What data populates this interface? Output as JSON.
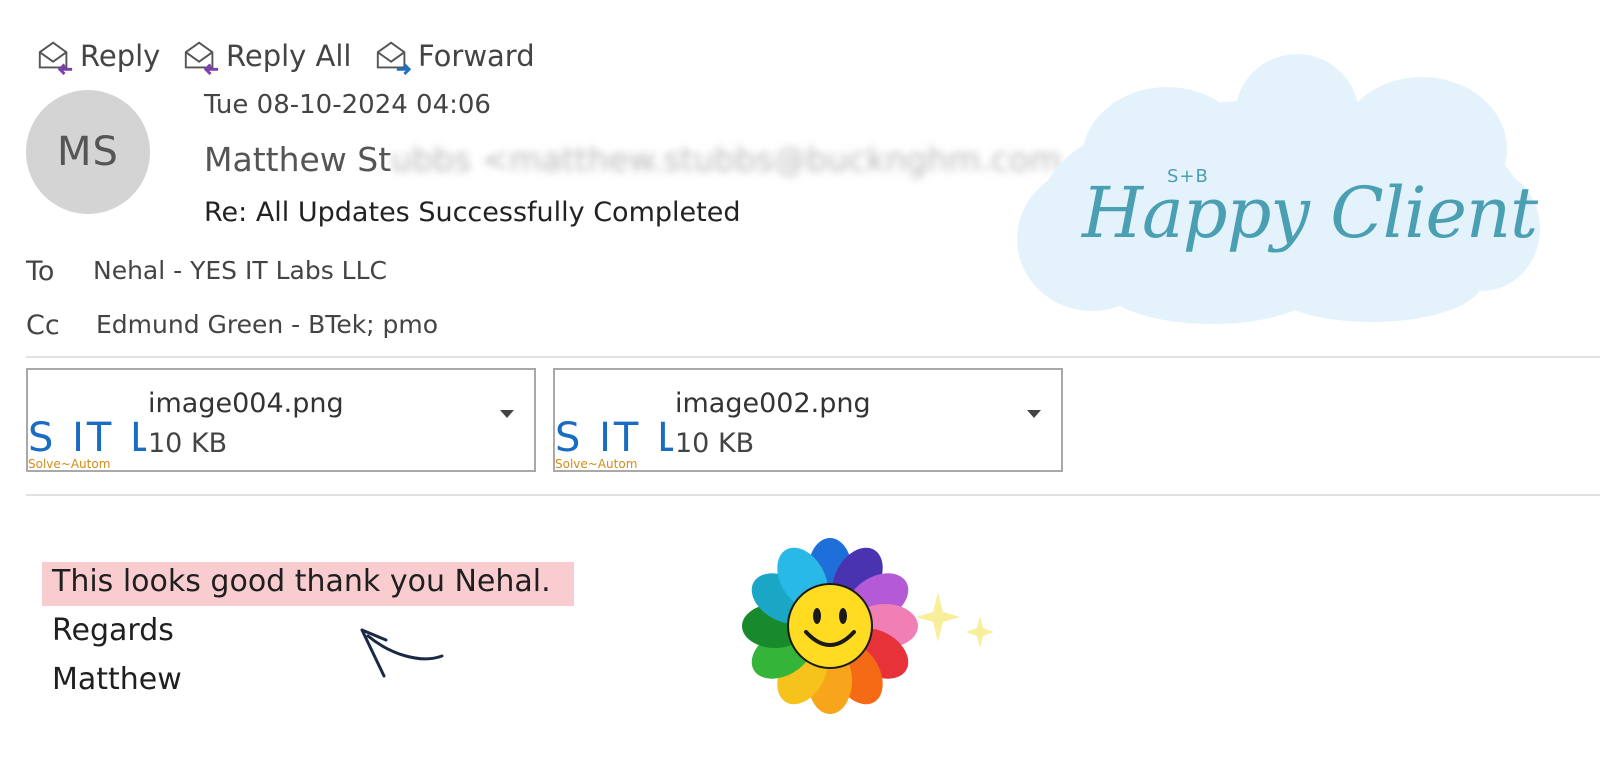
{
  "toolbar": {
    "reply_label": "Reply",
    "reply_all_label": "Reply All",
    "forward_label": "Forward"
  },
  "message": {
    "avatar_initials": "MS",
    "date": "Tue 08-10-2024 04:06",
    "sender_visible": "Matthew St",
    "subject": "Re: All Updates Successfully Completed",
    "to_label": "To",
    "to_value": "Nehal - YES IT Labs LLC",
    "cc_label": "Cc",
    "cc_value": "Edmund Green - BTek; pmo"
  },
  "attachments": [
    {
      "name": "image004.png",
      "size": "10 KB",
      "thumb_text": "S IT L",
      "thumb_tag": "Solve~Autom"
    },
    {
      "name": "image002.png",
      "size": "10 KB",
      "thumb_text": "S IT L",
      "thumb_tag": "Solve~Autom"
    }
  ],
  "body": {
    "line1": "This looks good thank you Nehal.",
    "line2": "Regards",
    "line3": "Matthew"
  },
  "badge": {
    "small_text": "S+B",
    "main_text": "Happy Client"
  },
  "colors": {
    "highlight": "#f9ccd0",
    "cloud": "#e4f3fb",
    "badge_text": "#4a9fb2",
    "reply_arrow": "#7b3fb0",
    "forward_arrow": "#1f6fc4"
  }
}
